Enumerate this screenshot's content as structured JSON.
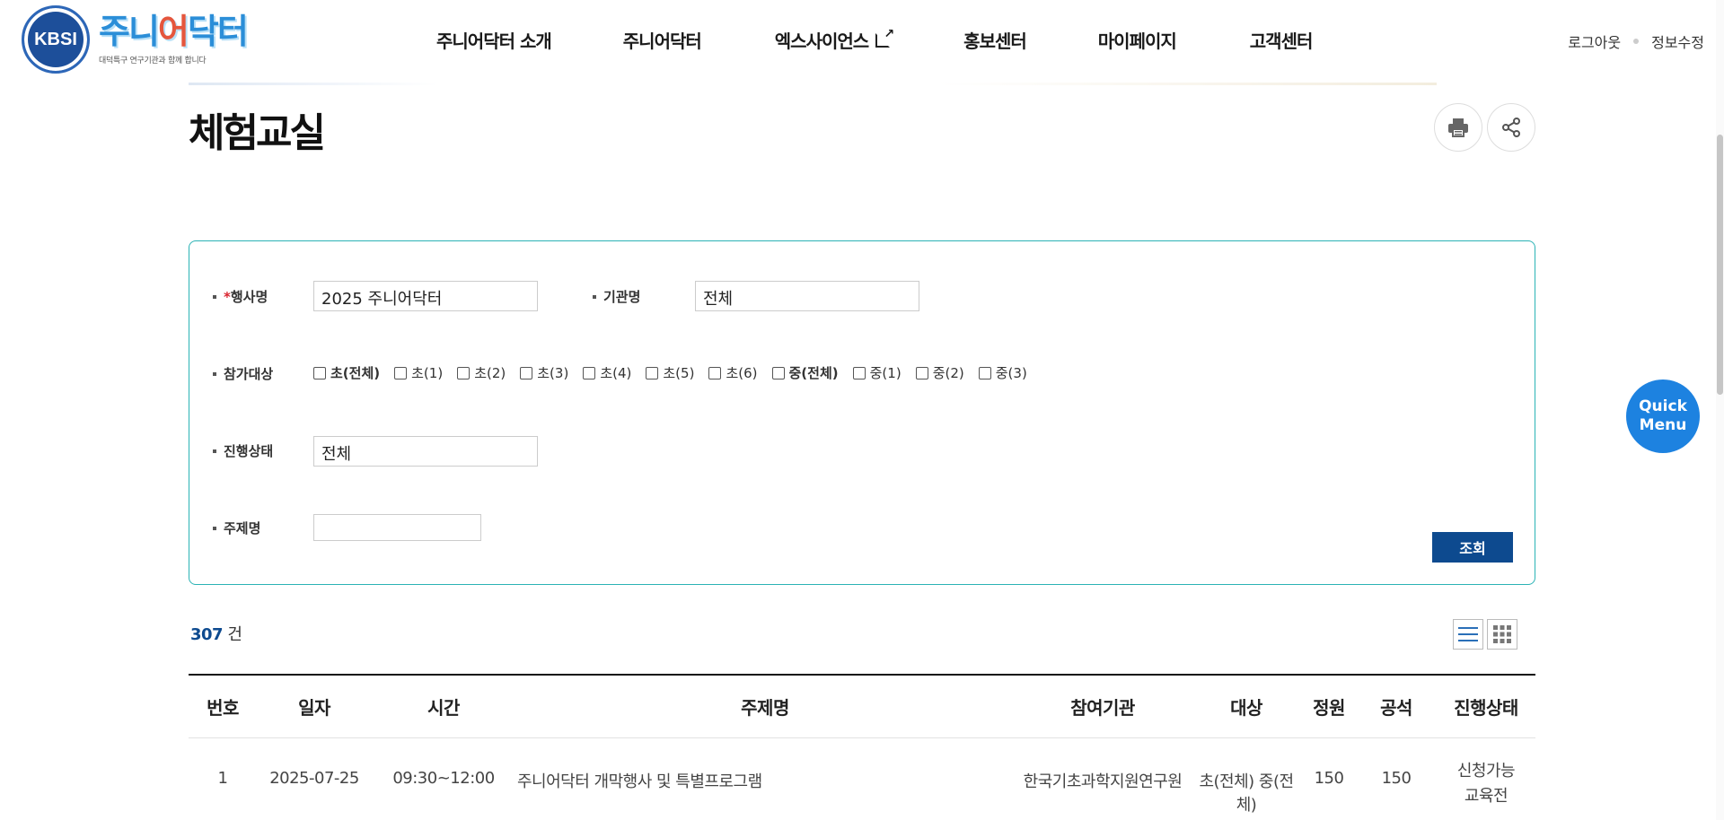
{
  "header": {
    "logo_seal_text": "KBSI",
    "brand_name_part1": "주니",
    "brand_name_accent": "어",
    "brand_name_part2": "닥터",
    "brand_tagline": "대덕특구 연구기관과 함께 합니다",
    "nav": [
      {
        "label": "주니어닥터 소개"
      },
      {
        "label": "주니어닥터"
      },
      {
        "label": "엑스사이언스",
        "external": true
      },
      {
        "label": "홍보센터"
      },
      {
        "label": "마이페이지"
      },
      {
        "label": "고객센터"
      }
    ],
    "util": {
      "logout": "로그아웃",
      "edit_profile": "정보수정"
    }
  },
  "page": {
    "title": "체험교실",
    "print_icon": "printer-icon",
    "share_icon": "share-icon"
  },
  "search": {
    "event_label_required": "*",
    "event_label": "행사명",
    "event_value": "2025 주니어닥터",
    "org_label": "기관명",
    "org_value": "전체",
    "target_label": "참가대상",
    "targets": [
      {
        "label": "초(전체)",
        "bold": true
      },
      {
        "label": "초(1)"
      },
      {
        "label": "초(2)"
      },
      {
        "label": "초(3)"
      },
      {
        "label": "초(4)"
      },
      {
        "label": "초(5)"
      },
      {
        "label": "초(6)"
      },
      {
        "label": "중(전체)",
        "bold": true
      },
      {
        "label": "중(1)"
      },
      {
        "label": "중(2)"
      },
      {
        "label": "중(3)"
      }
    ],
    "status_label": "진행상태",
    "status_value": "전체",
    "topic_label": "주제명",
    "topic_value": "",
    "submit_label": "조회"
  },
  "results": {
    "count": "307",
    "count_unit": "건",
    "list_view_icon": "list-view-icon",
    "grid_view_icon": "grid-view-icon"
  },
  "table": {
    "headers": [
      "번호",
      "일자",
      "시간",
      "주제명",
      "참여기관",
      "대상",
      "정원",
      "공석",
      "진행상태"
    ],
    "rows": [
      {
        "no": "1",
        "date": "2025-07-25",
        "time": "09:30~12:00",
        "topic": "주니어닥터 개막행사 및 특별프로그램",
        "org": "한국기초과학지원연구원",
        "target": "초(전체) 중(전체)",
        "capacity": "150",
        "vacancy": "150",
        "status_line1": "신청가능",
        "status_line2": "교육전"
      }
    ]
  },
  "quick_menu": {
    "line1": "Quick",
    "line2": "Menu"
  },
  "colors": {
    "accent_teal": "#2bb3b5",
    "button_navy": "#0d4a8f",
    "quick_blue": "#1d82e0",
    "required_red": "#d9232e"
  }
}
